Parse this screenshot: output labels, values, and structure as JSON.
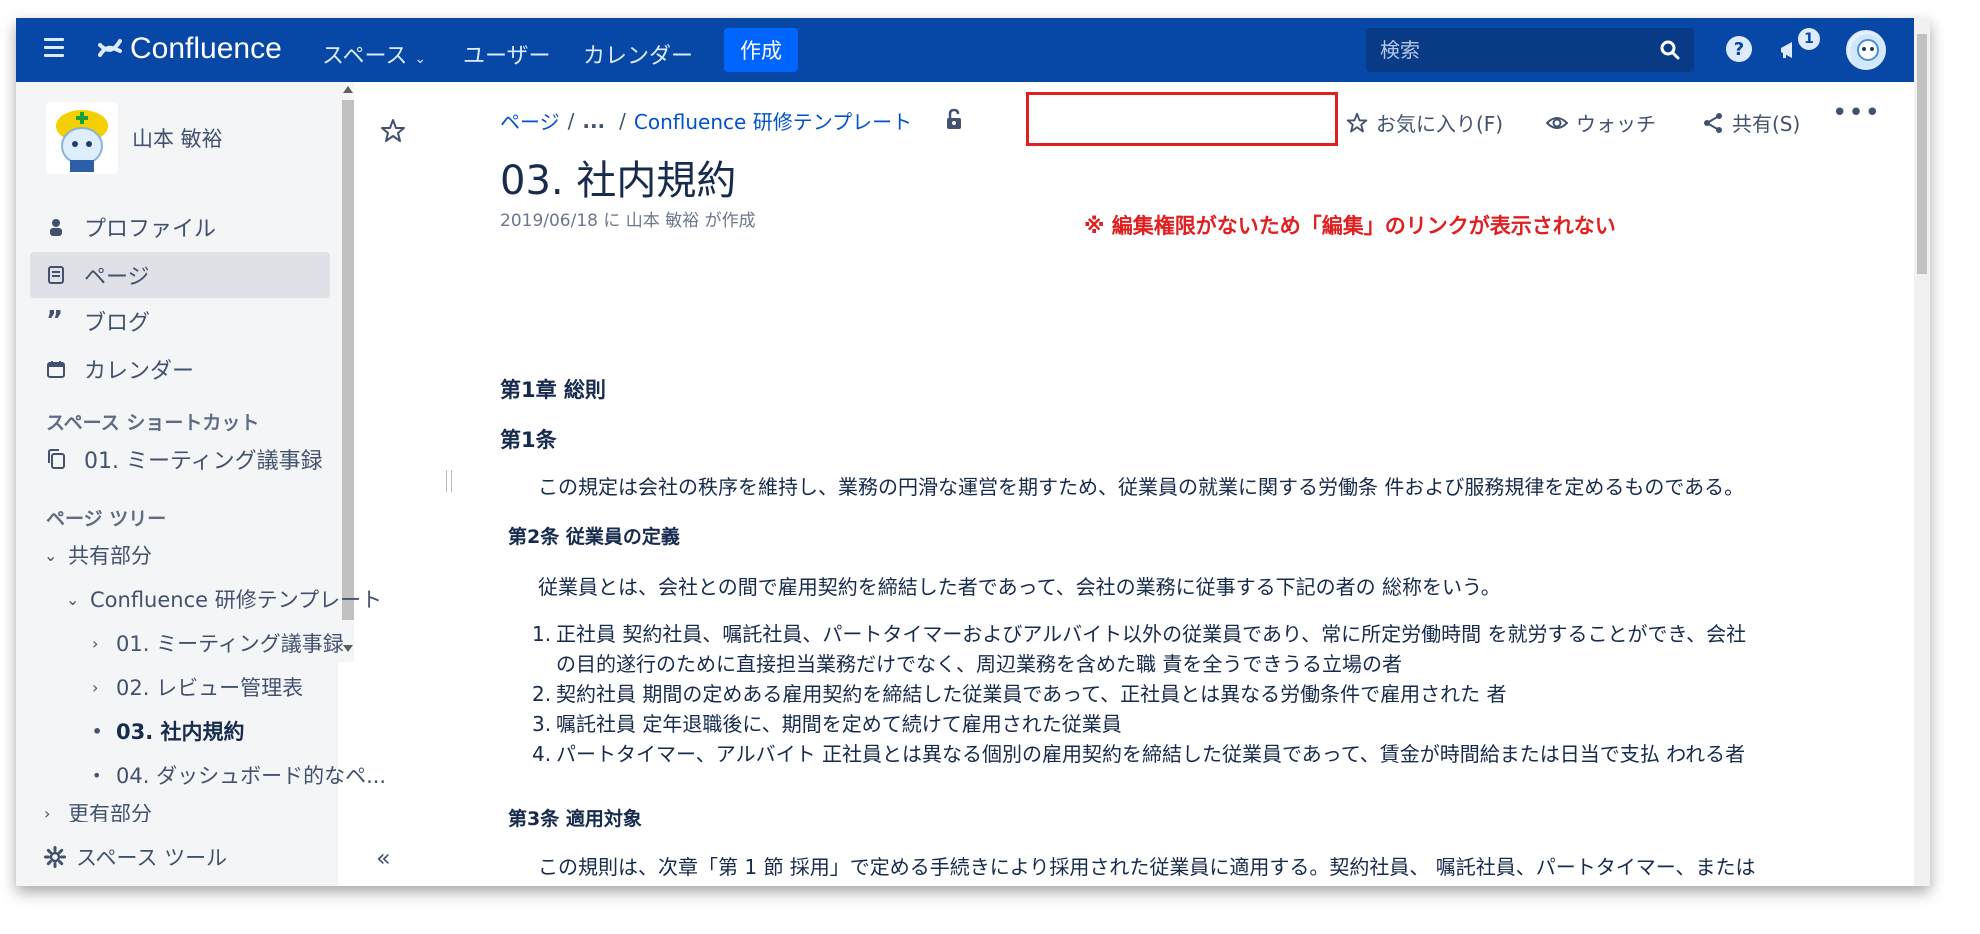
{
  "topnav": {
    "logo": "Confluence",
    "spaces": "スペース",
    "users": "ユーザー",
    "calendar": "カレンダー",
    "create": "作成",
    "search_placeholder": "検索",
    "notification_count": "1",
    "colors": {
      "bg": "#0747a6",
      "create_bg": "#0065ff"
    }
  },
  "sidebar": {
    "user_name": "山本 敏裕",
    "nav": [
      "プロファイル",
      "ページ",
      "ブログ",
      "カレンダー"
    ],
    "shortcuts_heading": "スペース ショートカット",
    "shortcut": "01. ミーティング議事録",
    "tree_heading": "ページ ツリー",
    "tree": [
      "共有部分",
      "Confluence 研修テンプレート",
      "01. ミーティング議事録",
      "02. レビュー管理表",
      "03. 社内規約",
      "04. ダッシュボード的なペ...",
      "更有部分"
    ],
    "space_tools": "スペース ツール"
  },
  "page": {
    "breadcrumb": [
      "ページ",
      "...",
      "Confluence 研修テンプレート"
    ],
    "actions": {
      "favorite": "お気に入り(F)",
      "watch": "ウォッチ",
      "share": "共有(S)"
    },
    "title": "03. 社内規約",
    "meta": "2019/06/18 に 山本 敏裕 が作成",
    "notice": "※ 編集権限がないため「編集」のリンクが表示されない",
    "chapter1": "第1章 総則",
    "art1_title": "第1条",
    "art1_body": "この規定は会社の秩序を維持し、業務の円滑な運営を期すため、従業員の就業に関する労働条 件および服務規律を定めるものである。",
    "art2_title": "第2条 従業員の定義",
    "art2_body": "従業員とは、会社との間で雇用契約を締結した者であって、会社の業務に従事する下記の者の 総称をいう。",
    "art2_list": [
      "正社員 契約社員、嘱託社員、パートタイマーおよびアルバイト以外の従業員であり、常に所定労働時間 を就労することができ、会社",
      "の目的遂行のために直接担当業務だけでなく、周辺業務を含めた職 責を全うできうる立場の者",
      "契約社員 期間の定めある雇用契約を締結した従業員であって、正社員とは異なる労働条件で雇用された 者",
      "嘱託社員 定年退職後に、期間を定めて続けて雇用された従業員",
      "パートタイマー、アルバイト 正社員とは異なる個別の雇用契約を締結した従業員であって、賃金が時間給または日当で支払 われる者"
    ],
    "art3_title": "第3条 適用対象",
    "art3_body": "この規則は、次章「第 1 節 採用」で定める手続きにより採用された従業員に適用する。契約社員、 嘱託社員、パートタイマー、または"
  }
}
